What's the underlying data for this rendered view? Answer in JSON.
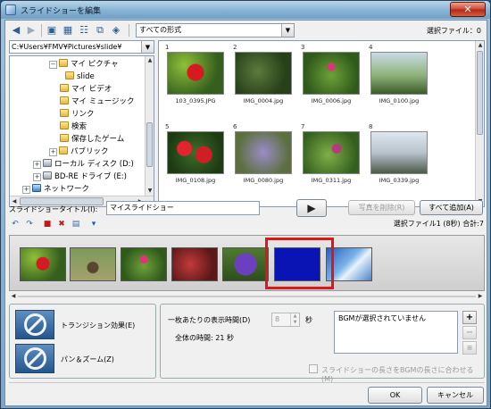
{
  "window": {
    "title": "スライドショーを編集",
    "close_label": "✕"
  },
  "toolbar": {
    "format_filter": "すべての形式",
    "selected_count": "選択ファイル：0"
  },
  "browser": {
    "path": "C:¥Users¥FMV¥Pictures¥slide¥",
    "tree": [
      {
        "label": "マイ ピクチャ",
        "expander": "−",
        "icon": "folder"
      },
      {
        "label": "slide",
        "expander": "",
        "icon": "folder"
      },
      {
        "label": "マイ ビデオ",
        "expander": "",
        "icon": "folder"
      },
      {
        "label": "マイ ミュージック",
        "expander": "",
        "icon": "folder"
      },
      {
        "label": "リンク",
        "expander": "",
        "icon": "folder"
      },
      {
        "label": "検索",
        "expander": "",
        "icon": "folder"
      },
      {
        "label": "保存したゲーム",
        "expander": "",
        "icon": "folder"
      },
      {
        "label": "パブリック",
        "expander": "+",
        "icon": "folder"
      },
      {
        "label": "ローカル ディスク (D:)",
        "expander": "+",
        "icon": "drive"
      },
      {
        "label": "BD-RE ドライブ (E:)",
        "expander": "+",
        "icon": "drive"
      },
      {
        "label": "ネットワーク",
        "expander": "+",
        "icon": "net"
      }
    ],
    "thumbnails": [
      {
        "num": "1",
        "name": "103_0395.JPG"
      },
      {
        "num": "2",
        "name": "IMG_0004.jpg"
      },
      {
        "num": "3",
        "name": "IMG_0006.jpg"
      },
      {
        "num": "4",
        "name": "IMG_0100.jpg"
      },
      {
        "num": "5",
        "name": "IMG_0108.jpg"
      },
      {
        "num": "6",
        "name": "IMG_0080.jpg"
      },
      {
        "num": "7",
        "name": "IMG_0311.jpg"
      },
      {
        "num": "8",
        "name": "IMG_0339.jpg"
      }
    ]
  },
  "slideshow": {
    "title_label": "スライドショータイトル(I):",
    "title_value": "マイスライドショー",
    "remove_label": "写真を削除(R)",
    "add_all_label": "すべて追加(A)",
    "summary": "選択ファイル1 (8秒) 合計:7"
  },
  "effects": {
    "transition_label": "トランジション効果(E)",
    "panzoom_label": "パン＆ズーム(Z)"
  },
  "timing": {
    "per_slide_label": "一枚あたりの表示時間(D)",
    "per_slide_value": "8",
    "seconds_unit": "秒",
    "total_label": "全体の時間: 21 秒",
    "bgm_status": "BGMが選択されていません",
    "fit_bgm_label": "スライドショーの長さをBGMの長さに合わせる(M)"
  },
  "footer": {
    "ok_label": "OK",
    "cancel_label": "キャンセル"
  },
  "colors": {
    "selected_slide": "#0a14b4",
    "highlight": "#e01515"
  }
}
